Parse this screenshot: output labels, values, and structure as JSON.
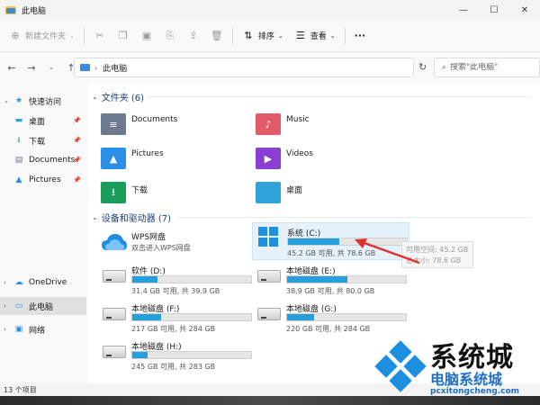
{
  "window": {
    "title": "此电脑",
    "controls": [
      "—",
      "☐",
      "✕"
    ]
  },
  "toolbar": {
    "new_label": "新建文件夹",
    "sort_label": "排序",
    "view_label": "查看",
    "more_label": "···"
  },
  "navigation": {
    "back": "←",
    "forward": "→",
    "up": "↑",
    "address_path": "此电脑",
    "address_sep": "›",
    "refresh": "↻",
    "search_icon": "⌕",
    "search_placeholder": "搜索\"此电脑\""
  },
  "sidebar": {
    "items": [
      {
        "label": "快速访问",
        "icon": "star-icon",
        "glyph": "★",
        "color": "#2c8fe6"
      },
      {
        "label": "桌面",
        "icon": "desktop-icon",
        "glyph": "▬",
        "color": "#2fa3d8",
        "pinned": true
      },
      {
        "label": "下载",
        "icon": "download-icon",
        "glyph": "⭳",
        "color": "#1a9c5a",
        "pinned": true
      },
      {
        "label": "Documents",
        "icon": "documents-icon",
        "glyph": "▤",
        "color": "#6b7a8f",
        "pinned": true
      },
      {
        "label": "Pictures",
        "icon": "pictures-icon",
        "glyph": "▲",
        "color": "#2c8fe6",
        "pinned": true
      },
      {
        "label": "OneDrive",
        "icon": "cloud-icon",
        "glyph": "☁",
        "color": "#2c8fe6"
      },
      {
        "label": "此电脑",
        "icon": "pc-icon",
        "glyph": "▭",
        "color": "#2c8fe6",
        "selected": true
      },
      {
        "label": "网络",
        "icon": "network-icon",
        "glyph": "▣",
        "color": "#2c8fe6"
      }
    ],
    "pin_glyph": "📌",
    "chevron_down": "⌄",
    "chevron_right": "›"
  },
  "main": {
    "folders_header": "文件夹 (6)",
    "folders": [
      {
        "label": "Documents",
        "color": "#6b7a8f",
        "glyph": "≡"
      },
      {
        "label": "Music",
        "color": "#e35a6a",
        "glyph": "♪"
      },
      {
        "label": "Pictures",
        "color": "#2c8fe6",
        "glyph": "▲"
      },
      {
        "label": "Videos",
        "color": "#8a3fd1",
        "glyph": "▶"
      },
      {
        "label": "下载",
        "color": "#1a9c5a",
        "glyph": "⭳"
      },
      {
        "label": "桌面",
        "color": "#2fa3d8",
        "glyph": ""
      }
    ],
    "drives_header": "设备和驱动器 (7)",
    "wps": {
      "name": "WPS网盘",
      "sub": "双击进入WPS网盘"
    },
    "drives": [
      {
        "name": "系统 (C:)",
        "info": "45.2 GB 可用, 共 78.6 GB",
        "used_fraction": 0.43,
        "selected": true,
        "os": true
      },
      {
        "name": "软件 (D:)",
        "info": "31.4 GB 可用, 共 39.9 GB",
        "used_fraction": 0.21
      },
      {
        "name": "本地磁盘 (E:)",
        "info": "38.9 GB 可用, 共 80.0 GB",
        "used_fraction": 0.51
      },
      {
        "name": "本地磁盘 (F:)",
        "info": "217 GB 可用, 共 284 GB",
        "used_fraction": 0.24
      },
      {
        "name": "本地磁盘 (G:)",
        "info": "220 GB 可用, 共 284 GB",
        "used_fraction": 0.23
      },
      {
        "name": "本地磁盘 (H:)",
        "info": "245 GB 可用, 共 283 GB",
        "used_fraction": 0.13
      }
    ],
    "tooltip": {
      "line1": "可用空间: 45.2 GB",
      "line2": "总大小: 78.6 GB"
    }
  },
  "status": {
    "count": "13 个项目"
  },
  "watermark": {
    "big": "系统城",
    "mid": "电脑系统城",
    "url": "pcxitongcheng.com"
  },
  "colors": {
    "accent": "#26a0da",
    "selection": "#e5f1fb",
    "arrow": "#e0312d"
  }
}
